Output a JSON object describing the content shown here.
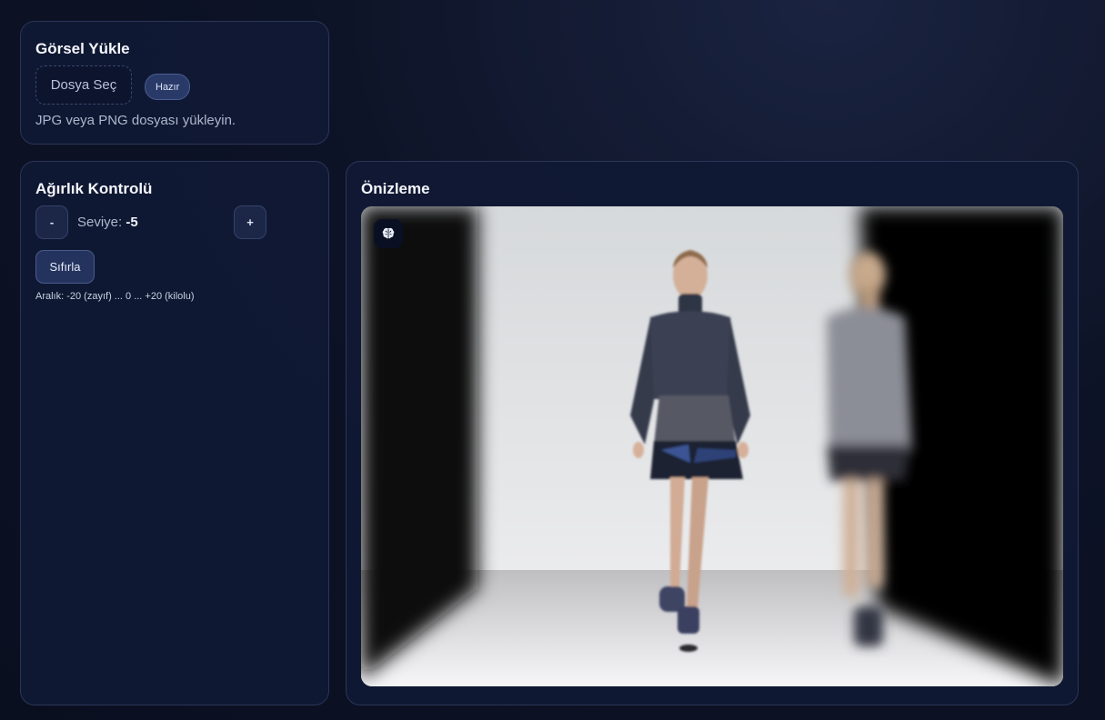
{
  "upload": {
    "title": "Görsel Yükle",
    "file_button": "Dosya Seç",
    "status": "Hazır",
    "hint": "JPG veya PNG dosyası yükleyin."
  },
  "weight": {
    "title": "Ağırlık Kontrolü",
    "minus": "-",
    "plus": "+",
    "level_label": "Seviye: ",
    "level_value": "-5",
    "reset": "Sıfırla",
    "range": "Aralık: -20 (zayıf) ... 0 ... +20 (kilolu)"
  },
  "preview": {
    "title": "Önizleme",
    "icon": "brain-icon"
  }
}
